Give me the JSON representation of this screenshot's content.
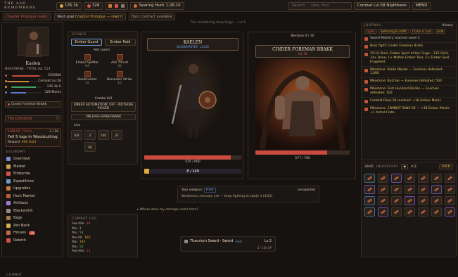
{
  "app": {
    "brand": "THE ASH REMEMBERS",
    "gold": "135.3k",
    "gems": "328",
    "hunt_label": "Searing Hunt",
    "hunt_time": "1:26:10",
    "search_placeholder": "Search ... (ore, fire)",
    "combat_level": "Combat Lvl.58 Nightbane",
    "menu": "MENU"
  },
  "notices": {
    "chapter_ready": "Chapter Prologue ready!",
    "next_goal_label": "Next goal",
    "next_goal": "Chapter Prologue — read it",
    "hunt_contract": "Hunt contract available"
  },
  "banner": "The smoldering deep forge — Lvl 5",
  "profile": {
    "name": "Kaelen",
    "title": "NIGHTBANE · TOTAL LVL 513",
    "hp": "535/600",
    "combat": "Combat Lvl.58",
    "gold": "135.3k G",
    "marks": "328 Marks",
    "weapon": "Cinder Foreman Brakk",
    "chronicle": "The Chronicle",
    "chronicle_count": "5"
  },
  "trail": {
    "title": "EMBER TRAIL",
    "progress": "3 / 19",
    "task": "Fell 5 logs in Woodcutting",
    "reward_label": "Reward:",
    "reward": "600 Gold"
  },
  "economy": {
    "heading": "ECONOMY",
    "items": [
      {
        "label": "Overview",
        "icon": "overview-icon",
        "color": "#7f8bd0"
      },
      {
        "label": "Market",
        "icon": "market-icon",
        "color": "#d2a04a"
      },
      {
        "label": "Emberide",
        "icon": "ember-icon",
        "color": "#d2544a"
      },
      {
        "label": "Expeditions",
        "icon": "expedition-icon",
        "color": "#6aa0d0"
      },
      {
        "label": "Upgrades",
        "icon": "upgrade-icon",
        "color": "#c97d3d"
      },
      {
        "label": "Hunt Market",
        "icon": "hunt-icon",
        "color": "#c05a3a"
      },
      {
        "label": "Artifacts",
        "icon": "artifact-icon",
        "color": "#a27adf"
      },
      {
        "label": "Blacksmith",
        "icon": "anvil-icon",
        "color": "#9a8a7a"
      },
      {
        "label": "Bags",
        "icon": "bag-icon",
        "color": "#a47a4a"
      },
      {
        "label": "Ash Bank",
        "icon": "bank-icon",
        "color": "#d5b04a"
      },
      {
        "label": "Houses",
        "icon": "house-icon",
        "color": "#c46b4a",
        "badge": "35"
      },
      {
        "label": "Rebirth",
        "icon": "rebirth-icon",
        "color": "#d2544a"
      }
    ],
    "combat_heading": "COMBAT"
  },
  "stance": {
    "heading": "STANCE",
    "guard": "Ember Guard",
    "raid": "Ember Raid",
    "leech": "Ash Leech",
    "skills": [
      {
        "name": "Ember Splitter",
        "val": "64"
      },
      {
        "name": "Ash Thrust",
        "val": "30"
      },
      {
        "name": "Skullcrusher",
        "val": "32"
      },
      {
        "name": "Berserker Strike",
        "val": "10"
      }
    ],
    "combo": "Combo 0/3",
    "automation": "EMBER AUTOMATION: OFF · NOTHING PICKED",
    "unleash": "UNLEASH EMBERBANE",
    "lure": "Lins",
    "slots": [
      "4/4",
      "2",
      "140",
      "31",
      "60"
    ]
  },
  "player": {
    "name": "KAELEN",
    "sub": "BLADEMASTER · LVL58",
    "hp": "535 / 600",
    "hp_frac": 0.89,
    "mana": "8 / 149",
    "mana_frac": 0.05
  },
  "enemy": {
    "bestiary": "Bestiary 0 / 10",
    "name": "CINDER FOREMAN BRAKK",
    "level": "LVL 58",
    "hp": "577 / 760",
    "hp_frac": 0.76
  },
  "weapon_info": {
    "label": "Your weapon:",
    "type": "Frost",
    "status": "unexplored",
    "desc": "Weakness unknown yet — keep fighting to study it (4/20)"
  },
  "damage_q": "Where does my damage come from?",
  "combat_log": {
    "heading": "COMBAT LOG",
    "rows": [
      {
        "k": "Foe hits",
        "v": "28",
        "c": "#d2544a"
      },
      {
        "k": "You",
        "v": "4",
        "c": "#76c06e"
      },
      {
        "k": "You",
        "v": "53",
        "c": "#76c06e"
      },
      {
        "k": "You hit",
        "v": "183",
        "c": "#e0a93a"
      },
      {
        "k": "You",
        "v": "183",
        "c": "#e0a93a"
      },
      {
        "k": "You",
        "v": "53",
        "c": "#76c06e"
      },
      {
        "k": "Foe hits",
        "v": "13",
        "c": "#d2544a"
      }
    ]
  },
  "sword": {
    "name": "Thaurium Sword - Sword",
    "type": "Frost",
    "lv": "Lv.3",
    "xp": "4 / 130 XP"
  },
  "journal": {
    "heading": "JOURNAL",
    "history": "History",
    "filters": [
      "Fights",
      "Gathering & crafts",
      "Crates & Loot",
      "Gold"
    ],
    "entries": [
      {
        "t": "Sword Mastery reached Level 3",
        "h": false
      },
      {
        "t": "Boss fight: Cinder Foreman Brakk",
        "h": true
      },
      {
        "t": "15:10 Slain: Ember Spirit of the Forge – 215 Gold, 14+ Bone, 1× Molten Ember Tear, 1× Ember Seal Fragment",
        "h": true
      },
      {
        "t": "Milestone: Blade Master — Enemies defeated: 1,000",
        "h": true
      },
      {
        "t": "Milestone: Butcher — Enemies defeated: 500",
        "h": true
      },
      {
        "t": "Milestone: First Hundred Blades — Enemies defeated: 100",
        "h": true
      },
      {
        "t": "Combat Rank 58 reached! +38 Ember Marks",
        "h": true
      },
      {
        "t": "Milestone: COMBAT RANK 58 — +38 Ember Marks · +1 Astral Crate",
        "h": true
      }
    ]
  },
  "inventory": {
    "heading": "INVENTORY",
    "count": "29/45",
    "sort": "A-Z",
    "open": "OPEN"
  }
}
